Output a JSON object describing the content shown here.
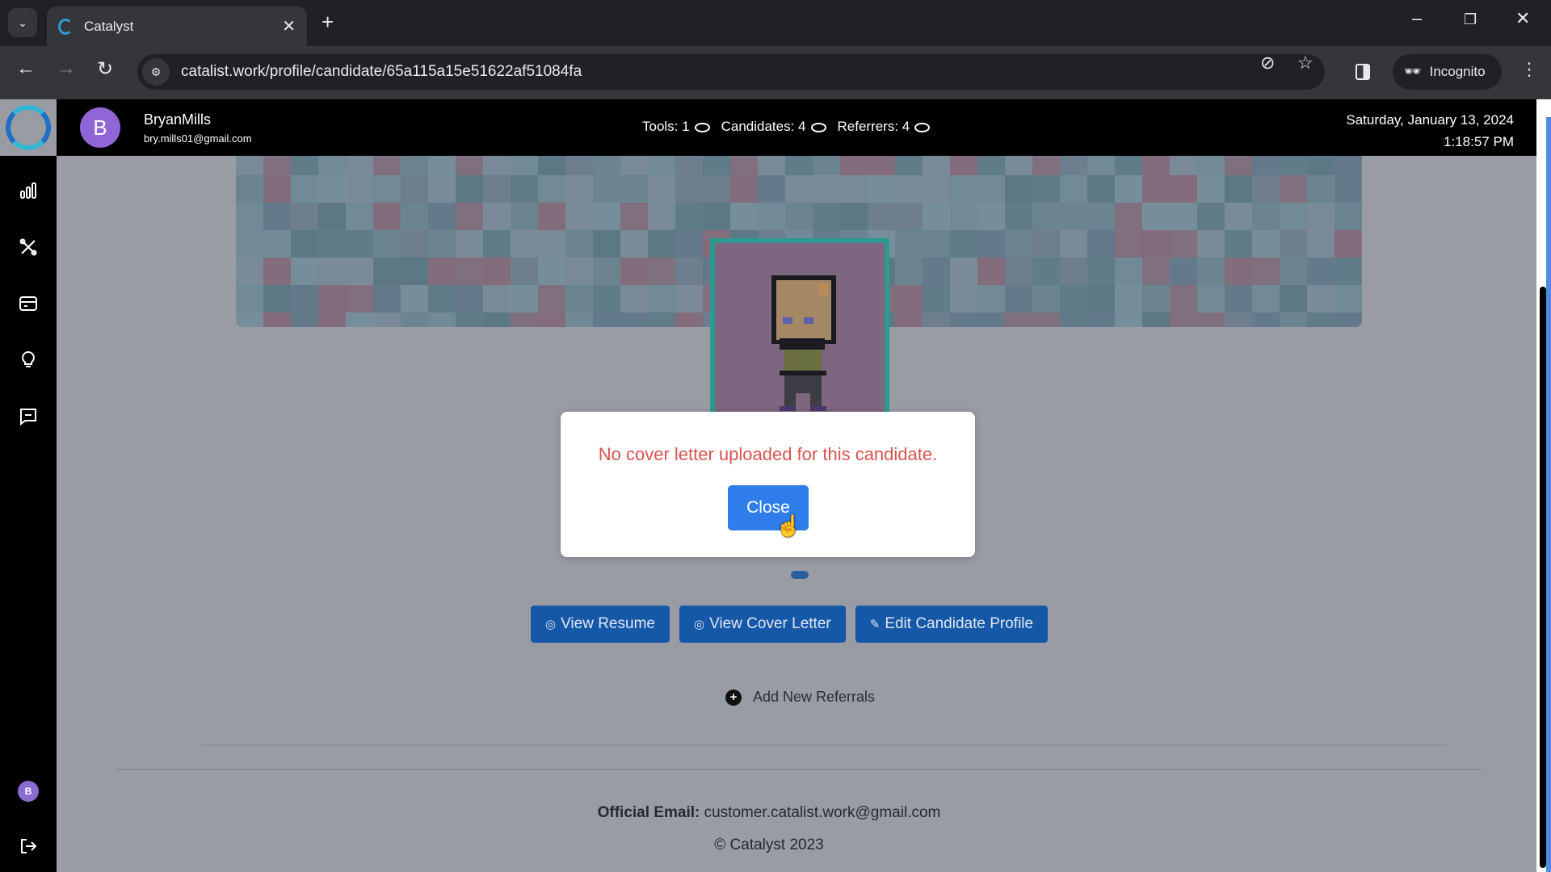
{
  "browser": {
    "tab_title": "Catalyst",
    "url": "catalist.work/profile/candidate/65a115a15e51622af51084fa",
    "incognito_label": "Incognito"
  },
  "header": {
    "avatar_letter": "B",
    "username": "BryanMills",
    "email": "bry.mills01@gmail.com",
    "stats": [
      {
        "label": "Tools: 1"
      },
      {
        "label": "Candidates: 4"
      },
      {
        "label": "Referrers: 4"
      }
    ],
    "date": "Saturday, January 13, 2024",
    "time": "1:18:57 PM"
  },
  "sidebar": {
    "items": [
      {
        "icon": "bar-chart-icon"
      },
      {
        "icon": "tools-icon"
      },
      {
        "icon": "card-icon"
      },
      {
        "icon": "lightbulb-icon"
      },
      {
        "icon": "message-icon"
      }
    ],
    "avatar_letter": "B"
  },
  "profile": {
    "actions": {
      "view_resume": "View Resume",
      "view_cover_letter": "View Cover Letter",
      "edit_profile": "Edit Candidate Profile"
    },
    "add_referrals": "Add New Referrals"
  },
  "footer": {
    "email_label": "Official Email:",
    "email_value": "customer.catalist.work@gmail.com",
    "copyright": "© Catalyst 2023"
  },
  "modal": {
    "message": "No cover letter uploaded for this candidate.",
    "close_label": "Close"
  },
  "colors": {
    "accent": "#1658a8",
    "modal_button": "#2f7de8",
    "error_text": "#d9534f",
    "avatar": "#9066d6"
  }
}
